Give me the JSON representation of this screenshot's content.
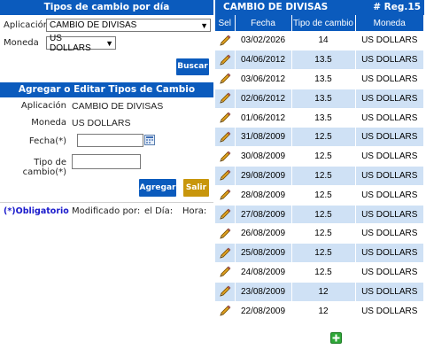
{
  "left": {
    "search_header": "Tipos de cambio por día",
    "aplicacion_label": "Aplicación",
    "aplicacion_value": "CAMBIO DE DIVISAS",
    "moneda_label": "Moneda",
    "moneda_value": "US DOLLARS",
    "buscar_label": "Buscar",
    "edit_header": "Agregar o Editar Tipos de Cambio",
    "edit_aplicacion_label": "Aplicación",
    "edit_aplicacion_value": "CAMBIO DE DIVISAS",
    "edit_moneda_label": "Moneda",
    "edit_moneda_value": "US DOLLARS",
    "fecha_label": "Fecha(*)",
    "fecha_value": "",
    "tipo_label": "Tipo de cambio(*)",
    "tipo_value": "",
    "agregar_label": "Agregar",
    "salir_label": "Salir",
    "obligatorio_label": "(*)Obligatorio",
    "modificado_label": "Modificado por:",
    "dia_label": "el Día:",
    "hora_label": "Hora:"
  },
  "right": {
    "title": "CAMBIO DE DIVISAS",
    "reg_count": "# Reg.15",
    "columns": [
      "Sel",
      "Fecha",
      "Tipo de cambio",
      "Moneda"
    ],
    "rows": [
      {
        "fecha": "03/02/2026",
        "tipo": "14",
        "moneda": "US DOLLARS"
      },
      {
        "fecha": "04/06/2012",
        "tipo": "13.5",
        "moneda": "US DOLLARS"
      },
      {
        "fecha": "03/06/2012",
        "tipo": "13.5",
        "moneda": "US DOLLARS"
      },
      {
        "fecha": "02/06/2012",
        "tipo": "13.5",
        "moneda": "US DOLLARS"
      },
      {
        "fecha": "01/06/2012",
        "tipo": "13.5",
        "moneda": "US DOLLARS"
      },
      {
        "fecha": "31/08/2009",
        "tipo": "12.5",
        "moneda": "US DOLLARS"
      },
      {
        "fecha": "30/08/2009",
        "tipo": "12.5",
        "moneda": "US DOLLARS"
      },
      {
        "fecha": "29/08/2009",
        "tipo": "12.5",
        "moneda": "US DOLLARS"
      },
      {
        "fecha": "28/08/2009",
        "tipo": "12.5",
        "moneda": "US DOLLARS"
      },
      {
        "fecha": "27/08/2009",
        "tipo": "12.5",
        "moneda": "US DOLLARS"
      },
      {
        "fecha": "26/08/2009",
        "tipo": "12.5",
        "moneda": "US DOLLARS"
      },
      {
        "fecha": "25/08/2009",
        "tipo": "12.5",
        "moneda": "US DOLLARS"
      },
      {
        "fecha": "24/08/2009",
        "tipo": "12.5",
        "moneda": "US DOLLARS"
      },
      {
        "fecha": "23/08/2009",
        "tipo": "12",
        "moneda": "US DOLLARS"
      },
      {
        "fecha": "22/08/2009",
        "tipo": "12",
        "moneda": "US DOLLARS"
      }
    ],
    "edit_icon": "pencil-icon",
    "add_icon": "add-icon"
  },
  "colors": {
    "header_blue": "#0b5bbd",
    "row_alt": "#cfe1f5",
    "gold_button": "#c8960c",
    "link_blue": "#1a1acc"
  }
}
